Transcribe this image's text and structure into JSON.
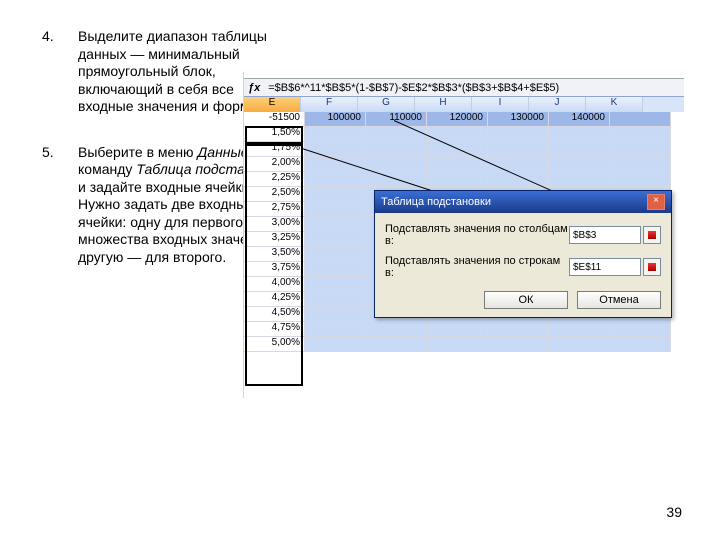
{
  "steps": [
    {
      "n": "4.",
      "text_parts": [
        "Выделите диапазон таблицы данных — минимальный прямоугольный блок, включающий в себя все входные значения и формулу."
      ]
    },
    {
      "n": "5.",
      "text_parts": [
        "Выберите в меню ",
        {
          "em": "Данные"
        },
        " команду ",
        {
          "em": "Таблица подстановки"
        },
        " и задайте входные ячейки. Нужно задать две входные ячейки: одну для первого множества входных значений, другую — для второго."
      ]
    }
  ],
  "page_number": "39",
  "screenshot": {
    "formula": "=$B$6*^11*$B$5*(1-$B$7)-$E$2*$B$3*($B$3+$B$4+$E$5)",
    "columns": [
      "E",
      "F",
      "G",
      "H",
      "I",
      "J",
      "K"
    ],
    "header_row": [
      "-51500",
      "100000",
      "110000",
      "120000",
      "130000",
      "140000"
    ],
    "left_values": [
      "1,50%",
      "1,75%",
      "2,00%",
      "2,25%",
      "2,50%",
      "2,75%",
      "3,00%",
      "3,25%",
      "3,50%",
      "3,75%",
      "4,00%",
      "4,25%",
      "4,50%",
      "4,75%",
      "5,00%"
    ],
    "dialog": {
      "title": "Таблица подстановки",
      "row1_label": "Подставлять значения по столбцам в:",
      "row1_value": "$B$3",
      "row2_label": "Подставлять значения по строкам в:",
      "row2_value": "$E$11",
      "ok": "ОК",
      "cancel": "Отмена"
    }
  }
}
